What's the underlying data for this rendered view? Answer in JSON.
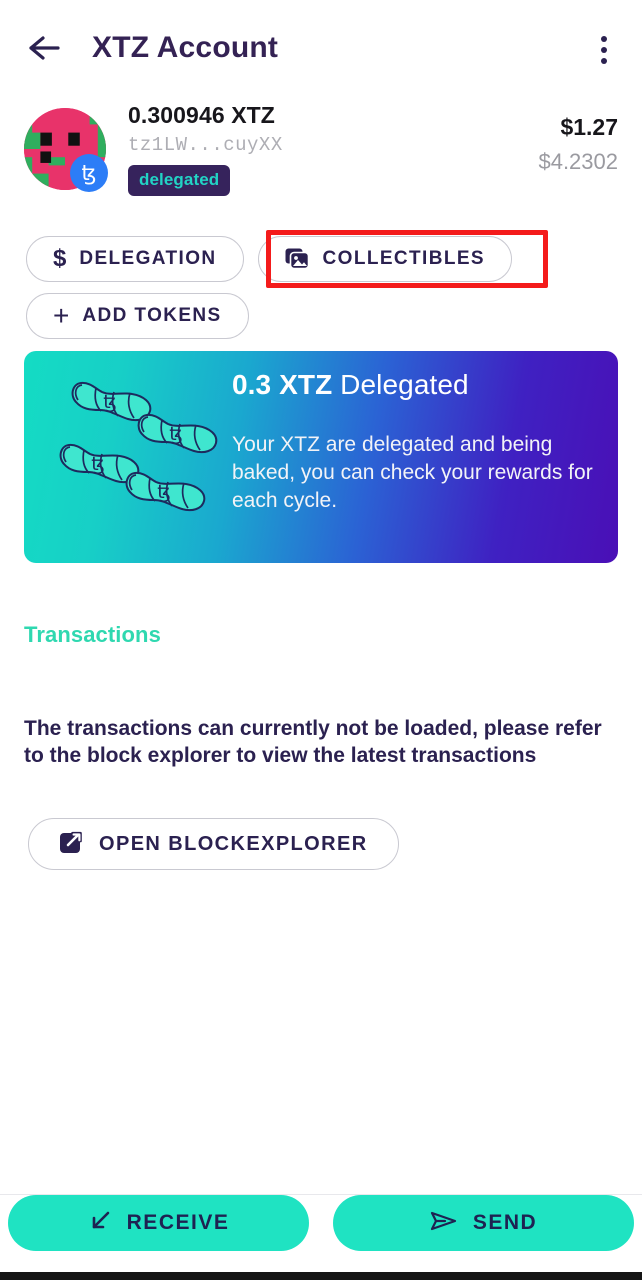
{
  "header": {
    "back_icon": "arrow-left-icon",
    "title": "XTZ Account",
    "overflow_icon": "more-vertical-icon"
  },
  "account": {
    "avatar_icon": "identicon-avatar",
    "chain_badge_icon": "tezos-logo-icon",
    "chain_badge_glyph": "ꜩ",
    "balance": "0.300946 XTZ",
    "address": "tz1LW...cuyXX",
    "status_badge": "delegated",
    "fiat_value": "$1.27",
    "fiat_rate": "$4.2302"
  },
  "actions": {
    "delegation": {
      "label": "DELEGATION",
      "icon": "dollar-icon",
      "glyph": "$"
    },
    "collectibles": {
      "label": "COLLECTIBLES",
      "icon": "images-stack-icon"
    },
    "add_tokens": {
      "label": "ADD TOKENS",
      "icon": "plus-icon",
      "glyph": "+"
    }
  },
  "highlight": {
    "target": "collectibles-button",
    "color": "#f41b1b"
  },
  "delegation_card": {
    "title_amount": "0.3 XTZ",
    "title_suffix": " Delegated",
    "body": "Your XTZ are delegated and being baked, you can check your rewards for each cycle.",
    "illustration_icon": "croissants-illustration",
    "gradient_from": "#14dcc4",
    "gradient_to": "#4a0fb6"
  },
  "transactions": {
    "heading": "Transactions",
    "heading_color": "#2fd8b0",
    "empty_message": "The transactions can currently not be loaded, please refer to the block explorer to view the latest transactions",
    "explorer_button": {
      "label": "OPEN BLOCKEXPLORER",
      "icon": "external-link-icon"
    }
  },
  "bottom_bar": {
    "receive": {
      "label": "RECEIVE",
      "icon": "arrow-down-left-icon"
    },
    "send": {
      "label": "SEND",
      "icon": "send-icon"
    },
    "button_color": "#1fe3c2"
  }
}
